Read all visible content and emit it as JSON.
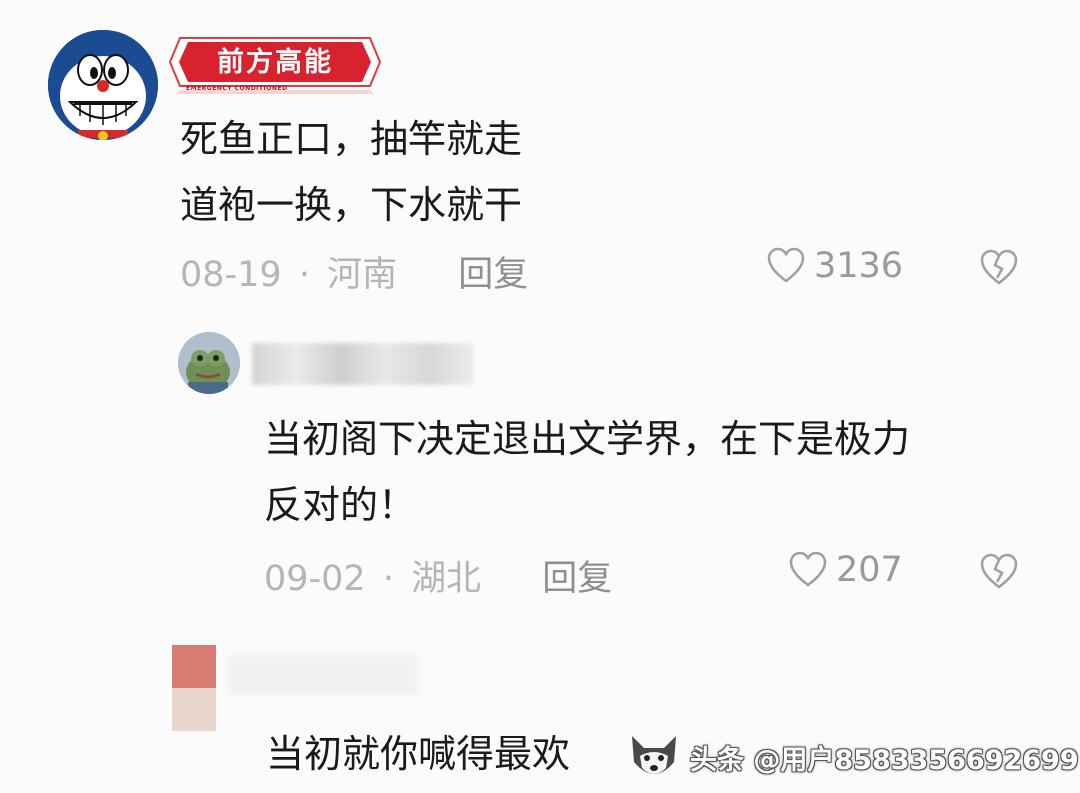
{
  "comments": [
    {
      "badge": "前方高能",
      "badge_sub": "EMERGENCY CONDITIONED",
      "lines": [
        "死鱼正口，抽竿就走",
        "道袍一换，下水就干"
      ],
      "date": "08-19",
      "dot": "·",
      "location": "河南",
      "reply_label": "回复",
      "likes": "3136"
    },
    {
      "lines": [
        "当初阁下决定退出文学界，在下是极力",
        "反对的！"
      ],
      "date": "09-02",
      "dot": "·",
      "location": "湖北",
      "reply_label": "回复",
      "likes": "207"
    },
    {
      "lines": [
        "当初就你喊得最欢"
      ]
    }
  ],
  "watermark": "头条 @用户8583356692699",
  "colors": {
    "badge_red": "#d8232f",
    "avatar_blue": "#1c4f96",
    "meta_gray": "#b5b5b5"
  }
}
